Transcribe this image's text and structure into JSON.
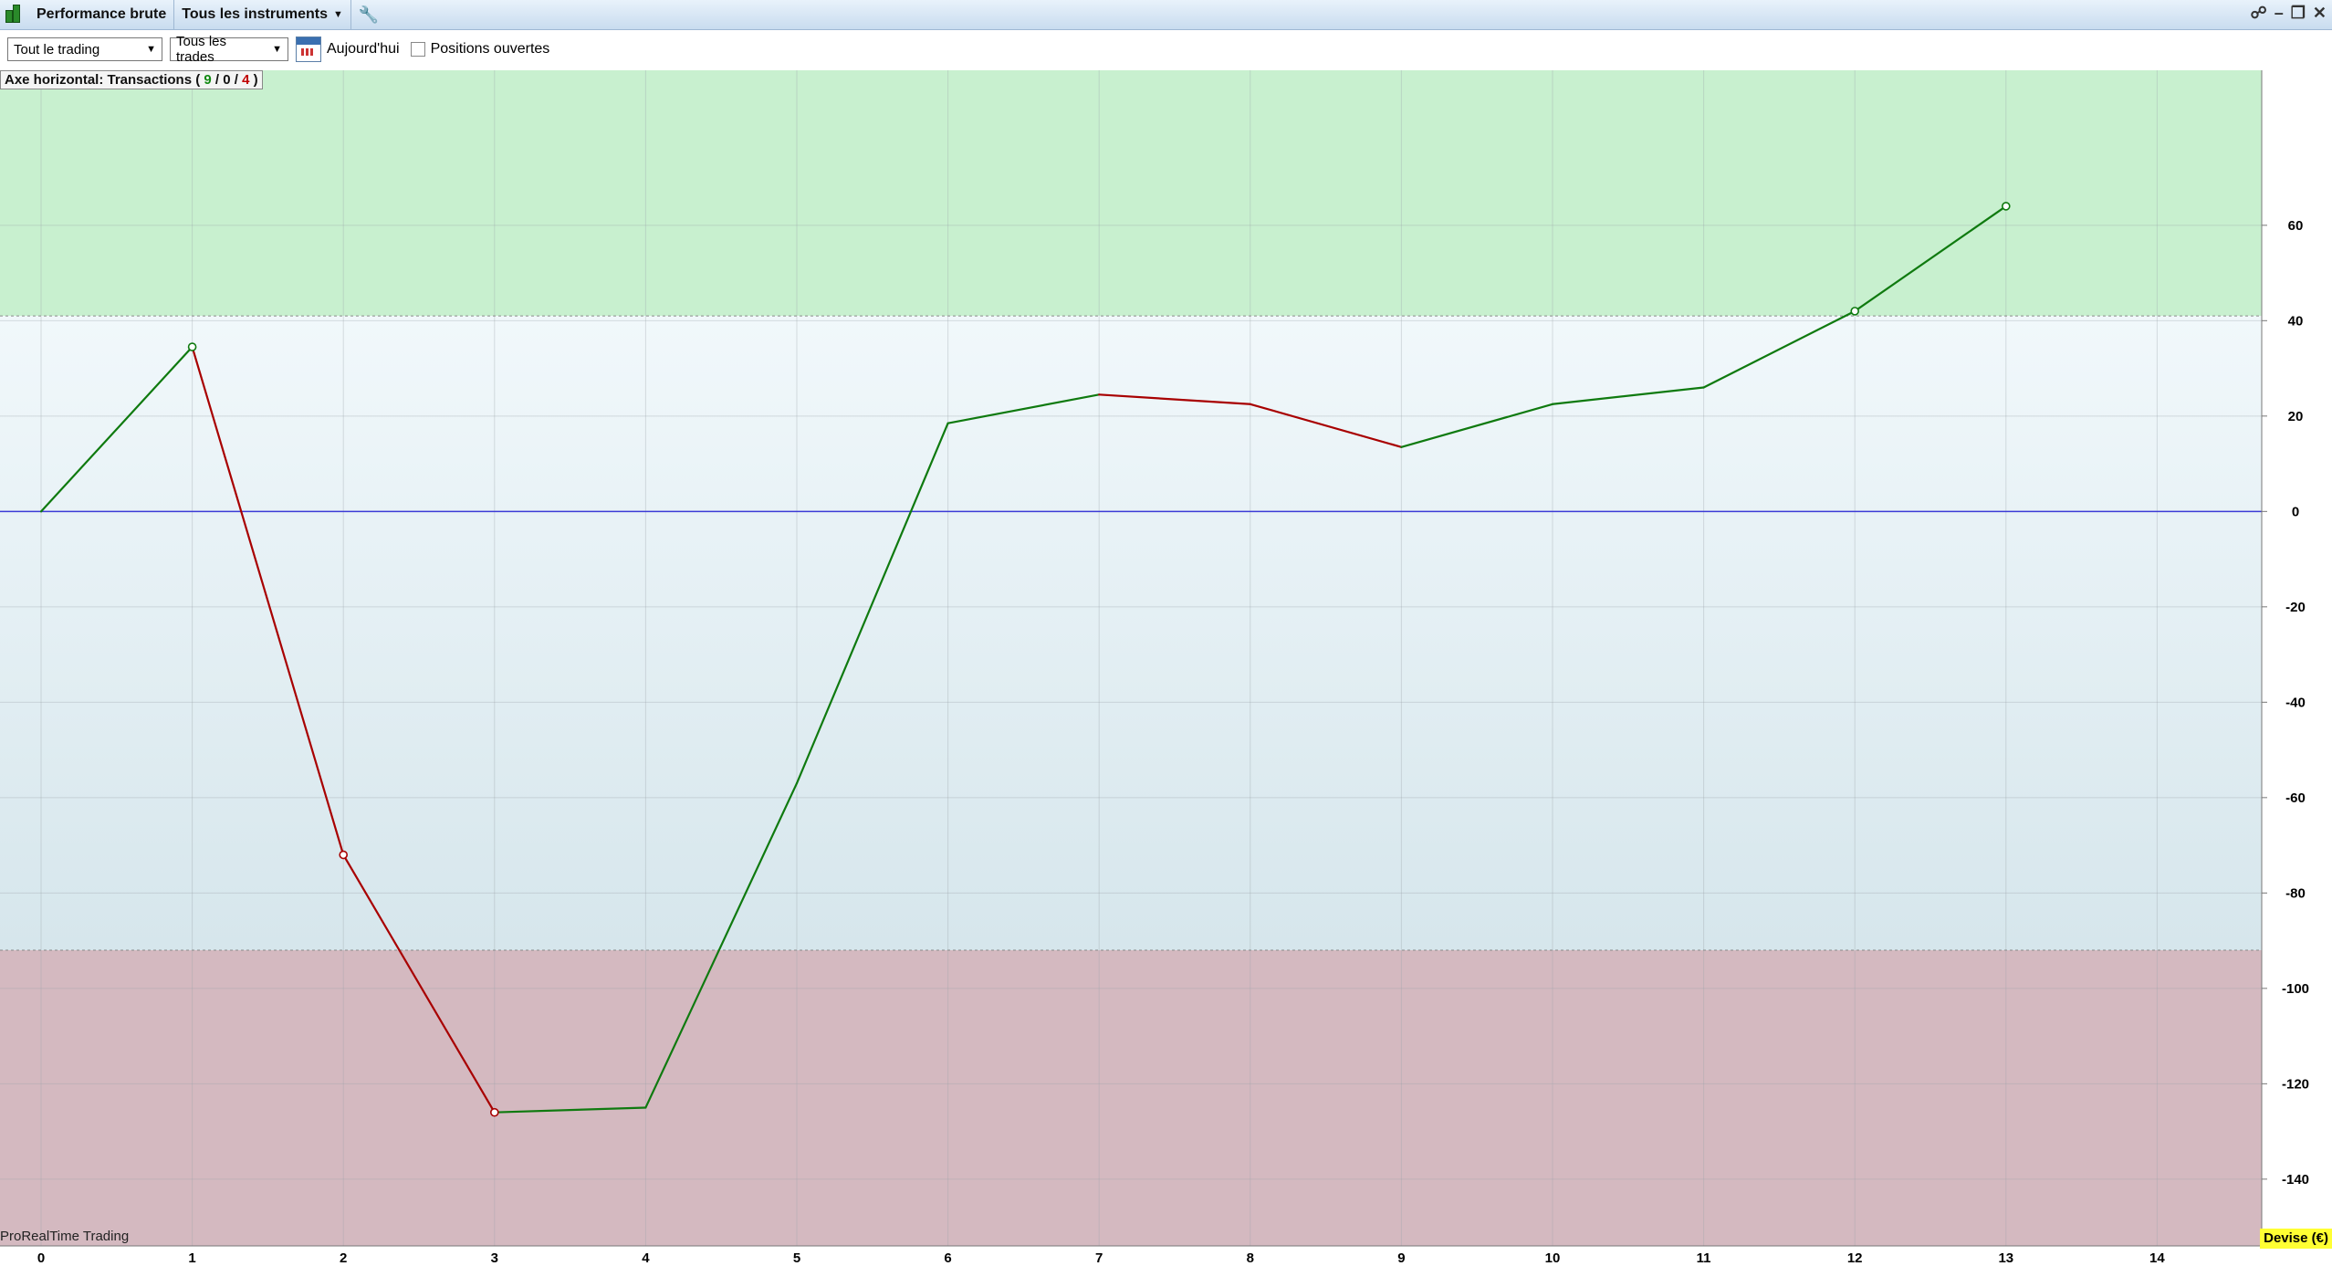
{
  "titlebar": {
    "performance_label": "Performance brute",
    "instruments_label": "Tous les instruments"
  },
  "toolbar": {
    "period_select": "Tout le trading",
    "trades_select": "Tous les trades",
    "today_label": "Aujourd'hui",
    "open_positions_label": "Positions ouvertes"
  },
  "axis_label": {
    "prefix": "Axe horizontal: Transactions",
    "wins": "9",
    "neutral": "0",
    "losses": "4"
  },
  "footer": {
    "brand": "ProRealTime Trading",
    "currency": "Devise (€)"
  },
  "colors": {
    "gain": "#0f7a0f",
    "loss": "#a80000",
    "zero_line": "#3b3bd6",
    "upper_band": "#c8f0cf",
    "lower_band": "#d4b9c0",
    "mid_top": "#f1f8fb",
    "mid_bottom": "#d6e6ec"
  },
  "icons": {
    "app": "candlestick-chart-icon",
    "wrench": "wrench-icon",
    "share": "share-icon",
    "calendar": "calendar-icon"
  },
  "chart_data": {
    "type": "line",
    "x": [
      0,
      1,
      2,
      3,
      4,
      5,
      6,
      7,
      8,
      9,
      10,
      11,
      12,
      13
    ],
    "y": [
      0,
      34.5,
      -72,
      -126,
      -125,
      -57,
      18.5,
      24.5,
      22.5,
      13.5,
      22.5,
      26,
      42,
      64
    ],
    "segment_colors": [
      "gain",
      "loss",
      "loss",
      "gain",
      "gain",
      "gain",
      "gain",
      "loss",
      "loss",
      "gain",
      "gain",
      "gain",
      "gain"
    ],
    "markers": [
      {
        "x": 1,
        "y": 34.5,
        "color": "gain"
      },
      {
        "x": 2,
        "y": -72,
        "color": "loss"
      },
      {
        "x": 3,
        "y": -126,
        "color": "loss"
      },
      {
        "x": 12,
        "y": 42,
        "color": "gain"
      },
      {
        "x": 13,
        "y": 64,
        "color": "gain"
      }
    ],
    "xlim": [
      0,
      14.7
    ],
    "ylim": [
      -154,
      92.5
    ],
    "x_ticks": [
      0,
      1,
      2,
      3,
      4,
      5,
      6,
      7,
      8,
      9,
      10,
      11,
      12,
      13,
      14
    ],
    "y_ticks": [
      60,
      40,
      20,
      0,
      -20,
      -40,
      -60,
      -80,
      -100,
      -120,
      -140
    ],
    "upper_threshold": 41,
    "lower_threshold": -92,
    "grid": true,
    "y_axis_side": "right"
  }
}
